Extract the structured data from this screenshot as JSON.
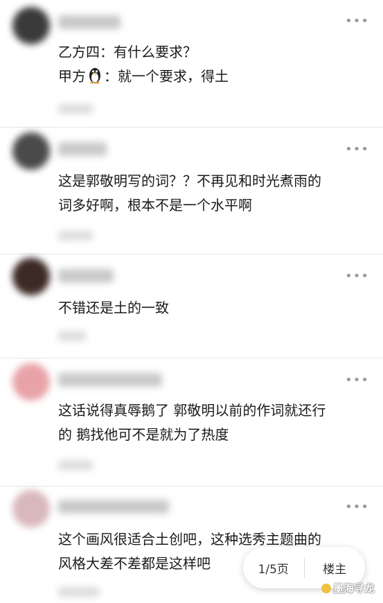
{
  "comments": [
    {
      "line1": "乙方四：有什么要求？",
      "line2a": "甲方",
      "line2b": "：就一个要求，得土",
      "avatar_color": "#3a3a3a"
    },
    {
      "line1": "这是郭敬明写的词？？不再见和时光煮雨的",
      "line2": "词多好啊，根本不是一个水平啊",
      "avatar_color": "#4a4a4a"
    },
    {
      "line1": "不错还是土的一致",
      "avatar_color": "#3c2a26"
    },
    {
      "line1": "这话说得真辱鹅了 郭敬明以前的作词就还行",
      "line2": "的 鹅找他可不是就为了热度",
      "avatar_color": "#e8a3a8"
    },
    {
      "line1": "这个画风很适合土创吧，这种选秀主题曲的",
      "line2": "风格大差不差都是这样吧",
      "avatar_color": "#d9b8bc"
    }
  ],
  "more_icon": "more-dots-icon",
  "pager": {
    "page": "1/5页",
    "owner": "楼主"
  },
  "watermark": "墨海寻龙"
}
